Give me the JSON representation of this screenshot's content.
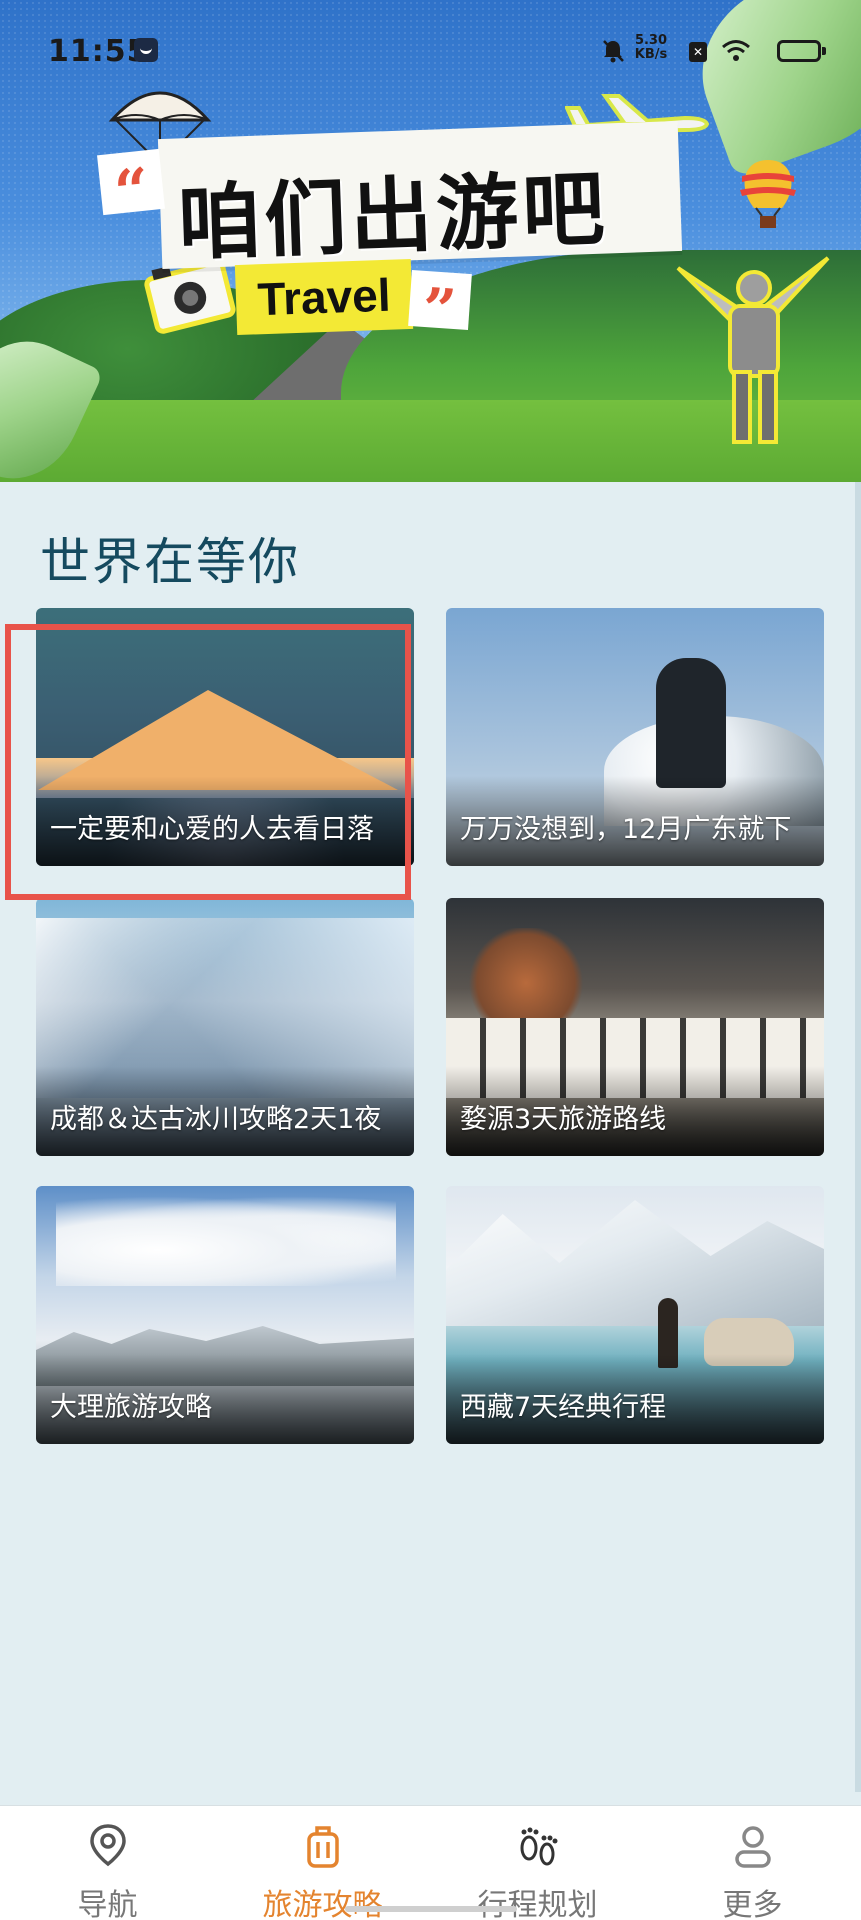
{
  "status_bar": {
    "time": "11:55",
    "net_speed_value": "5.30",
    "net_speed_unit": "KB/s",
    "sim_label": "✕"
  },
  "banner": {
    "title": "咱们出游吧",
    "tag": "Travel",
    "quote_open": "“",
    "quote_close": "”"
  },
  "section": {
    "title": "世界在等你"
  },
  "cards": [
    {
      "caption": "一定要和心爱的人去看日落"
    },
    {
      "caption": "万万没想到，12月广东就下"
    },
    {
      "caption": "成都＆达古冰川攻略2天1夜"
    },
    {
      "caption": "婺源3天旅游路线"
    },
    {
      "caption": "大理旅游攻略"
    },
    {
      "caption": "西藏7天经典行程"
    }
  ],
  "bottom_nav": {
    "items": [
      {
        "label": "导航",
        "icon": "location-pin-icon",
        "active": false
      },
      {
        "label": "旅游攻略",
        "icon": "suitcase-icon",
        "active": true
      },
      {
        "label": "行程规划",
        "icon": "footprints-icon",
        "active": false
      },
      {
        "label": "更多",
        "icon": "user-icon",
        "active": false
      }
    ]
  },
  "colors": {
    "accent": "#e4842f",
    "highlight_border": "#e8534a",
    "section_title": "#154a5f",
    "page_bg": "#e2eef2"
  }
}
